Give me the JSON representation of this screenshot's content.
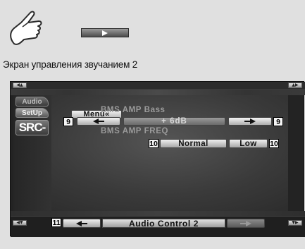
{
  "manual": {
    "hand_icon": "tap-finger-icon",
    "next_arrow_icon": "play-arrow-icon",
    "heading": "Экран управления звучанием 2"
  },
  "screen": {
    "top_left_icon": "volume-up-icon",
    "top_right_icon": "track-next-icon",
    "bottom_left_icon": "volume-down-icon",
    "bottom_right_icon": "track-prev-icon",
    "tabs": {
      "audio": "Audio",
      "setup": "SetUp"
    },
    "src_label": "SRC-",
    "menu_label": "Menu«",
    "bass": {
      "label": "BMS AMP Bass",
      "value": "+ 6dB",
      "down_icon": "arrow-left-icon",
      "up_icon": "arrow-right-icon"
    },
    "freq": {
      "label": "BMS AMP FREQ",
      "options": [
        "Normal",
        "Low"
      ]
    },
    "callouts": {
      "bass_left": "9",
      "bass_right": "9",
      "freq_left": "10",
      "freq_right": "10",
      "page_nav": "11"
    },
    "bottom": {
      "title": "Audio Control 2",
      "prev_icon": "arrow-left-icon",
      "next_icon": "arrow-right-icon"
    }
  },
  "colors": {
    "screen_bg": "#232323",
    "button_light": "#f0f0f0",
    "label_dim": "#9b9b9b"
  }
}
